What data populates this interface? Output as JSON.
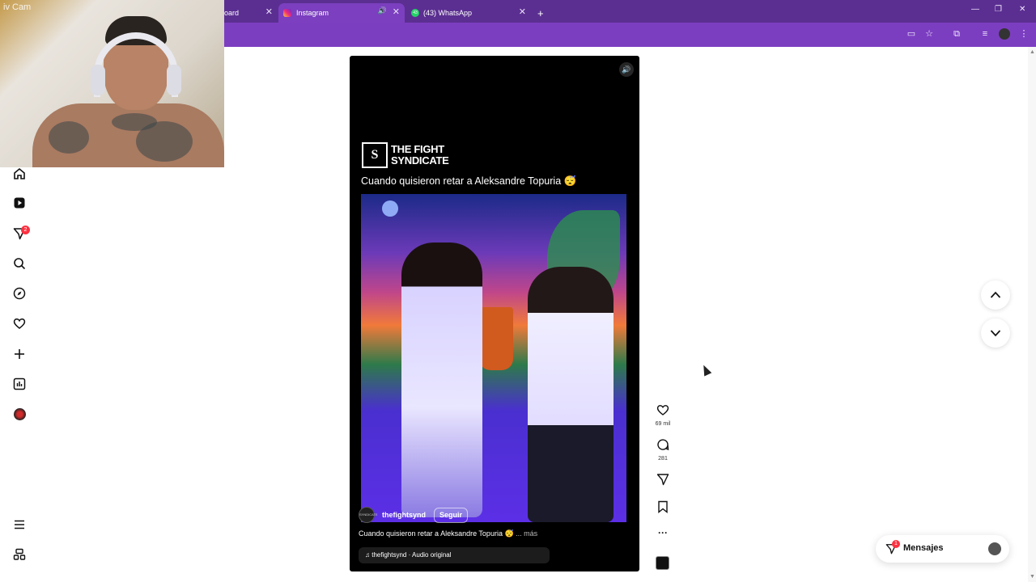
{
  "browser": {
    "tabs": [
      {
        "label": "oard",
        "active": false
      },
      {
        "label": "Instagram",
        "active": true
      },
      {
        "label": "(43) WhatsApp",
        "active": false
      }
    ],
    "whatsapp_badge": "43"
  },
  "webcam": {
    "label": "iv Cam"
  },
  "sidebar": {
    "notifications_badge": "2",
    "items": [
      {
        "name": "home-icon"
      },
      {
        "name": "reels-icon"
      },
      {
        "name": "direct-icon"
      },
      {
        "name": "search-icon"
      },
      {
        "name": "explore-icon"
      },
      {
        "name": "heart-icon"
      },
      {
        "name": "create-icon"
      },
      {
        "name": "dashboard-icon"
      },
      {
        "name": "profile-avatar"
      },
      {
        "name": "menu-icon"
      },
      {
        "name": "more-apps-icon"
      }
    ]
  },
  "reel": {
    "brand_logo": "TF\nS",
    "brand_name": "THE FIGHT SYNDICATE",
    "headline": "Cuando quisieron retar a Aleksandre Topuria 😴",
    "username": "thefightsynd",
    "follow_label": "Seguir",
    "caption": "Cuando quisieron retar a Aleksandre Topuria 😴",
    "more_label": "... más",
    "audio": "♫ thefightsynd · Audio original",
    "user_avatar_text": "SYNDICATE"
  },
  "actions": {
    "likes": "69 mil",
    "comments": "281"
  },
  "messages": {
    "label": "Mensajes",
    "badge": "1"
  },
  "colors": {
    "tabstrip": "#5b2f91",
    "toolbar": "#7c3ec1",
    "notification_red": "#ff3040"
  }
}
